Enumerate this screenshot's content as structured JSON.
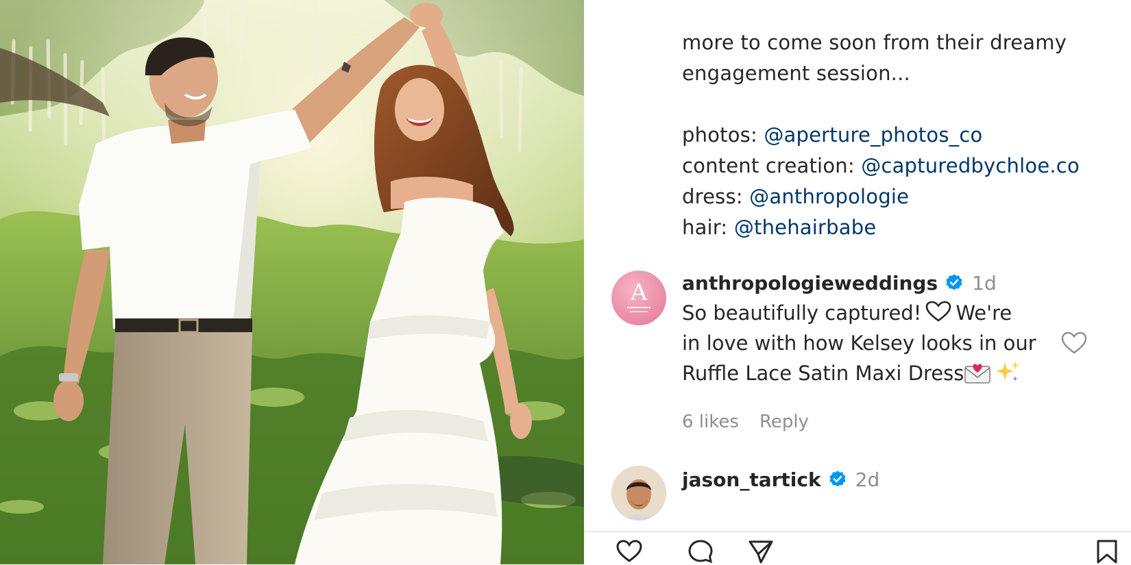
{
  "post": {
    "caption_lines": [
      "more to come soon from their dreamy",
      "engagement session..."
    ],
    "credits": [
      {
        "label": "photos:",
        "handle": "@aperture_photos_co"
      },
      {
        "label": "content creation:",
        "handle": "@capturedbychloe.co"
      },
      {
        "label": "dress:",
        "handle": "@anthropologie"
      },
      {
        "label": "hair:",
        "handle": "@thehairbabe"
      }
    ]
  },
  "comments": [
    {
      "username": "anthropologieweddings",
      "verified": true,
      "time": "1d",
      "avatar_letter": "A",
      "text_lines": [
        "So beautifully captured!",
        "We're",
        "in love with how Kelsey looks in our",
        "Ruffle Lace Satin Maxi Dress"
      ],
      "emojis": [
        "love-letter-icon",
        "sparkles-icon"
      ],
      "likes": "6 likes",
      "reply_label": "Reply"
    },
    {
      "username": "jason_tartick",
      "verified": true,
      "time": "2d"
    }
  ],
  "colors": {
    "text": "#262626",
    "mention": "#00376b",
    "muted": "#8e8e8e",
    "verified": "#0095f6",
    "avatar_pink": "#eb8fa8"
  },
  "icons": [
    "heart-icon",
    "verified-badge-icon",
    "comment-icon",
    "share-icon",
    "save-icon"
  ]
}
